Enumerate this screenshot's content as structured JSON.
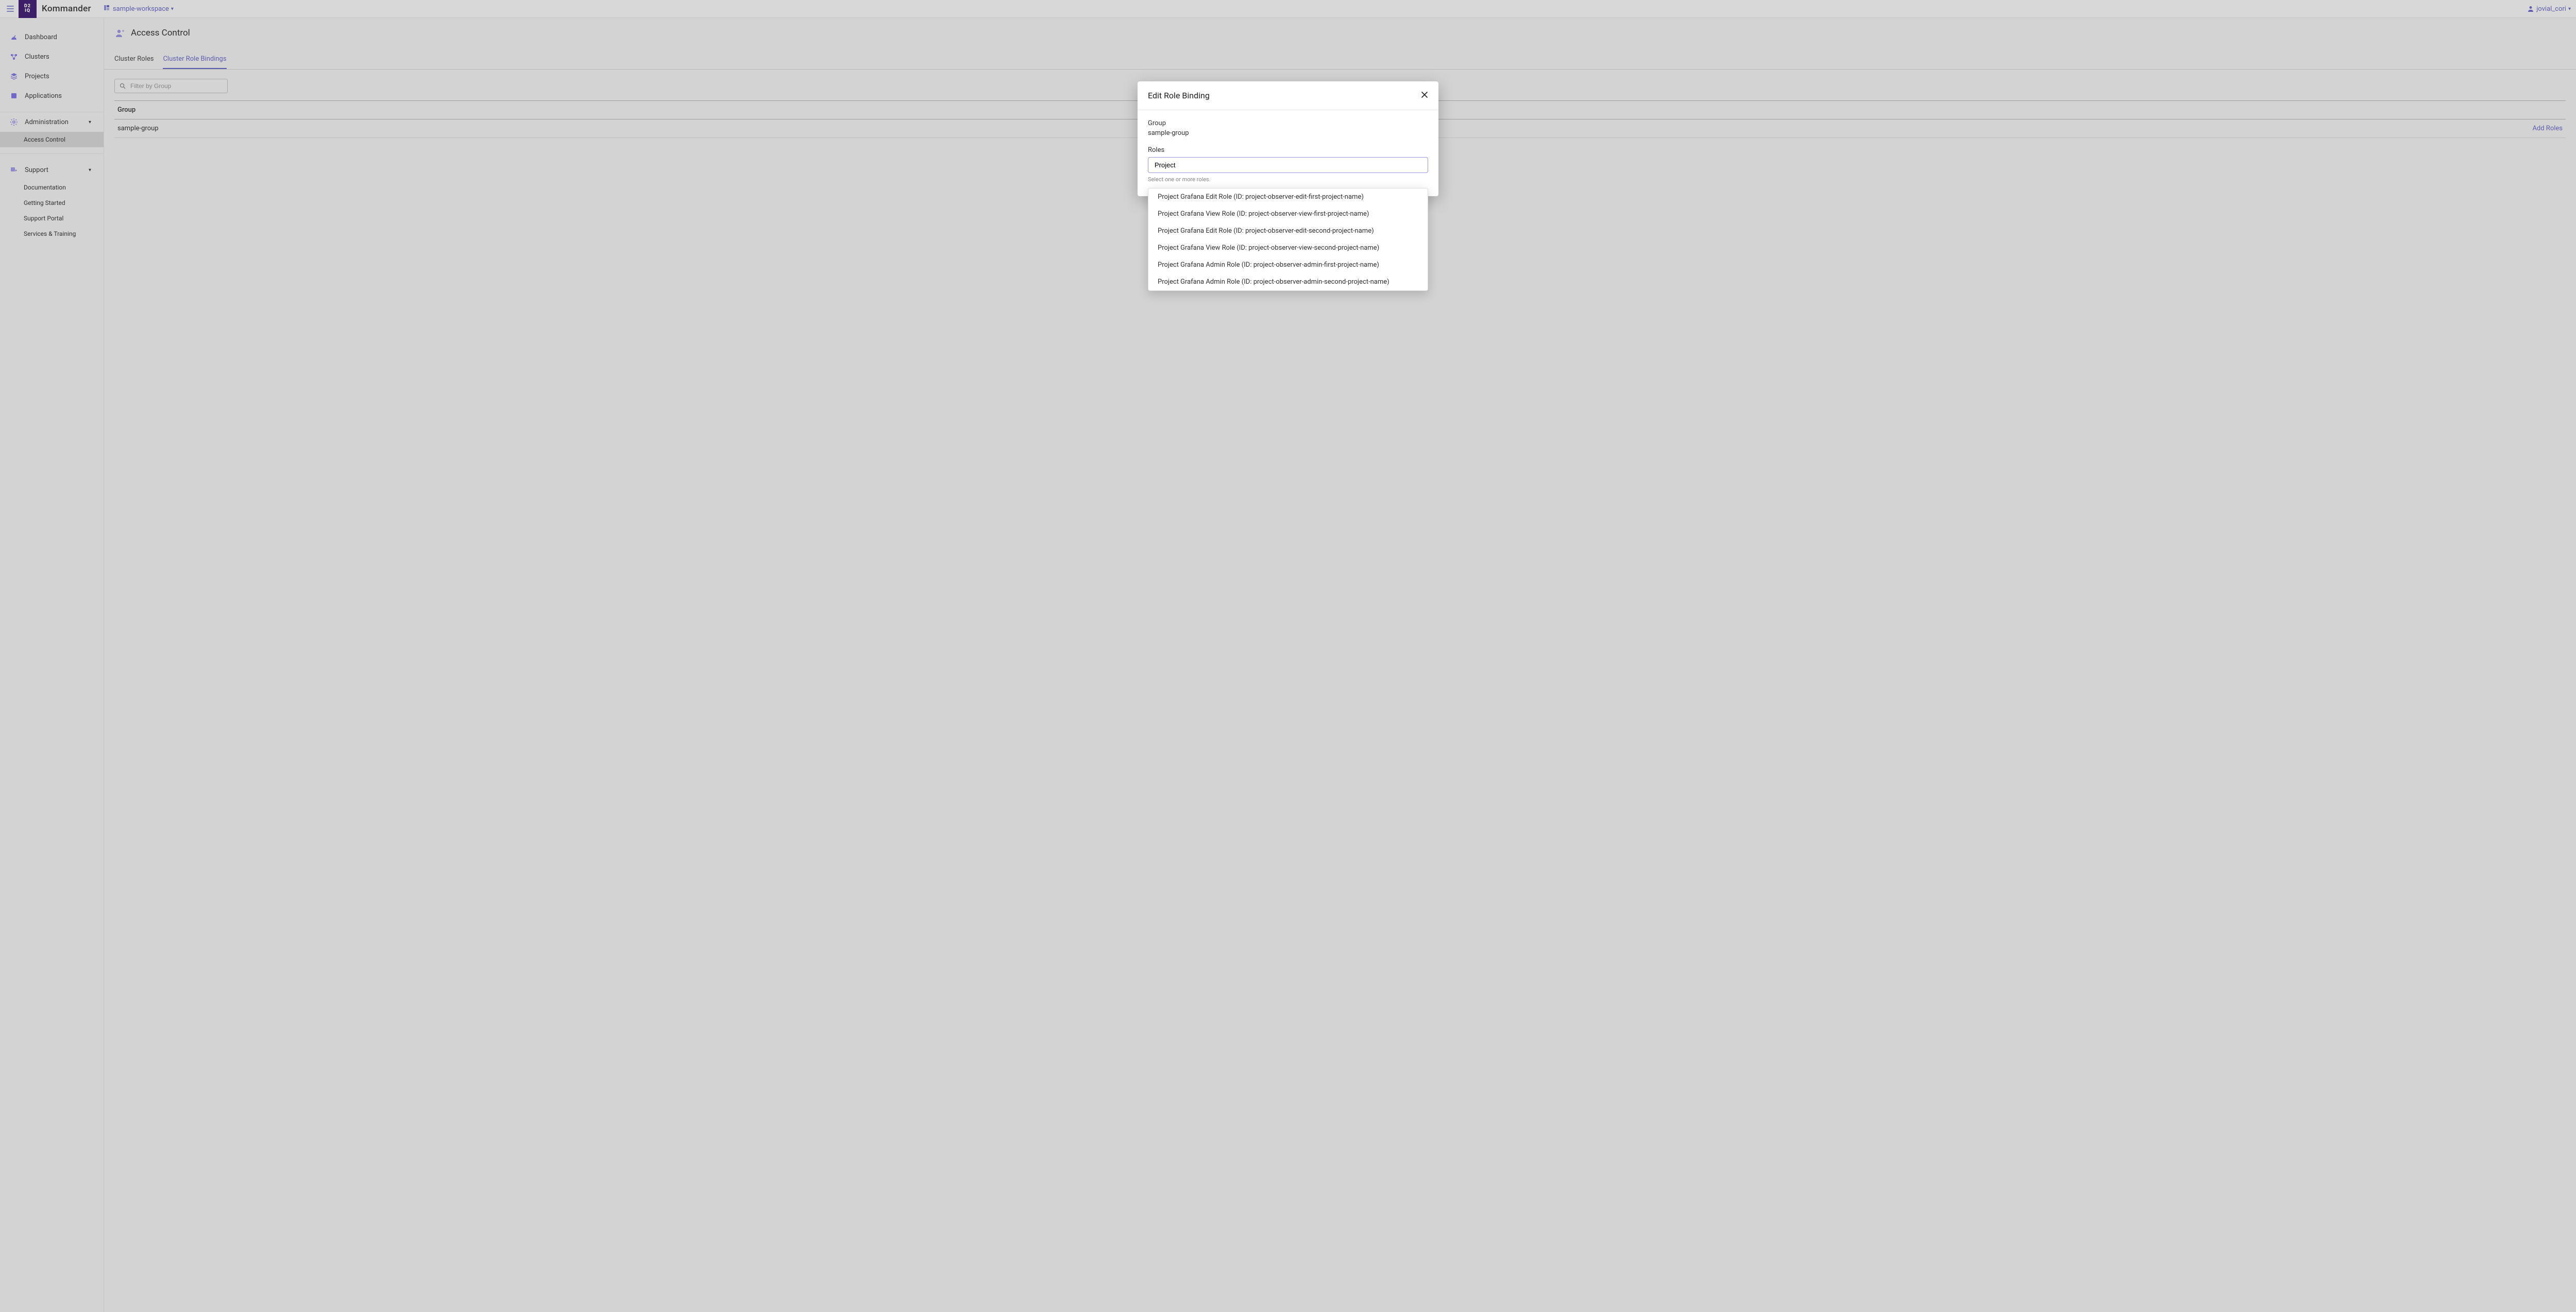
{
  "topbar": {
    "brand": "Kommander",
    "logo_text_top": "D2",
    "logo_text_bottom": "IQ",
    "workspace_label": "sample-workspace",
    "username": "jovial_cori"
  },
  "sidebar": {
    "primary": [
      {
        "icon": "dashboard-icon",
        "label": "Dashboard"
      },
      {
        "icon": "clusters-icon",
        "label": "Clusters"
      },
      {
        "icon": "projects-icon",
        "label": "Projects"
      },
      {
        "icon": "applications-icon",
        "label": "Applications"
      }
    ],
    "admin_label": "Administration",
    "admin_subitems": [
      {
        "label": "Access Control",
        "active": true
      }
    ],
    "support_label": "Support",
    "support_subitems": [
      {
        "label": "Documentation"
      },
      {
        "label": "Getting Started"
      },
      {
        "label": "Support Portal"
      },
      {
        "label": "Services & Training"
      }
    ]
  },
  "page": {
    "title": "Access Control",
    "tabs": [
      {
        "label": "Cluster Roles",
        "active": false
      },
      {
        "label": "Cluster Role Bindings",
        "active": true
      }
    ],
    "filter_placeholder": "Filter by Group",
    "table": {
      "columns": [
        "Group",
        ""
      ],
      "rows": [
        {
          "group": "sample-group",
          "action": "Add Roles"
        }
      ]
    }
  },
  "modal": {
    "title": "Edit Role Binding",
    "group_label": "Group",
    "group_value": "sample-group",
    "roles_label": "Roles",
    "roles_input_value": "Project",
    "hint": "Select one or more roles.",
    "options": [
      "Project Grafana Edit Role (ID: project-observer-edit-first-project-name)",
      "Project Grafana View Role (ID: project-observer-view-first-project-name)",
      "Project Grafana Edit Role (ID: project-observer-edit-second-project-name)",
      "Project Grafana View Role (ID: project-observer-view-second-project-name)",
      "Project Grafana Admin Role (ID: project-observer-admin-first-project-name)",
      "Project Grafana Admin Role (ID: project-observer-admin-second-project-name)"
    ]
  }
}
